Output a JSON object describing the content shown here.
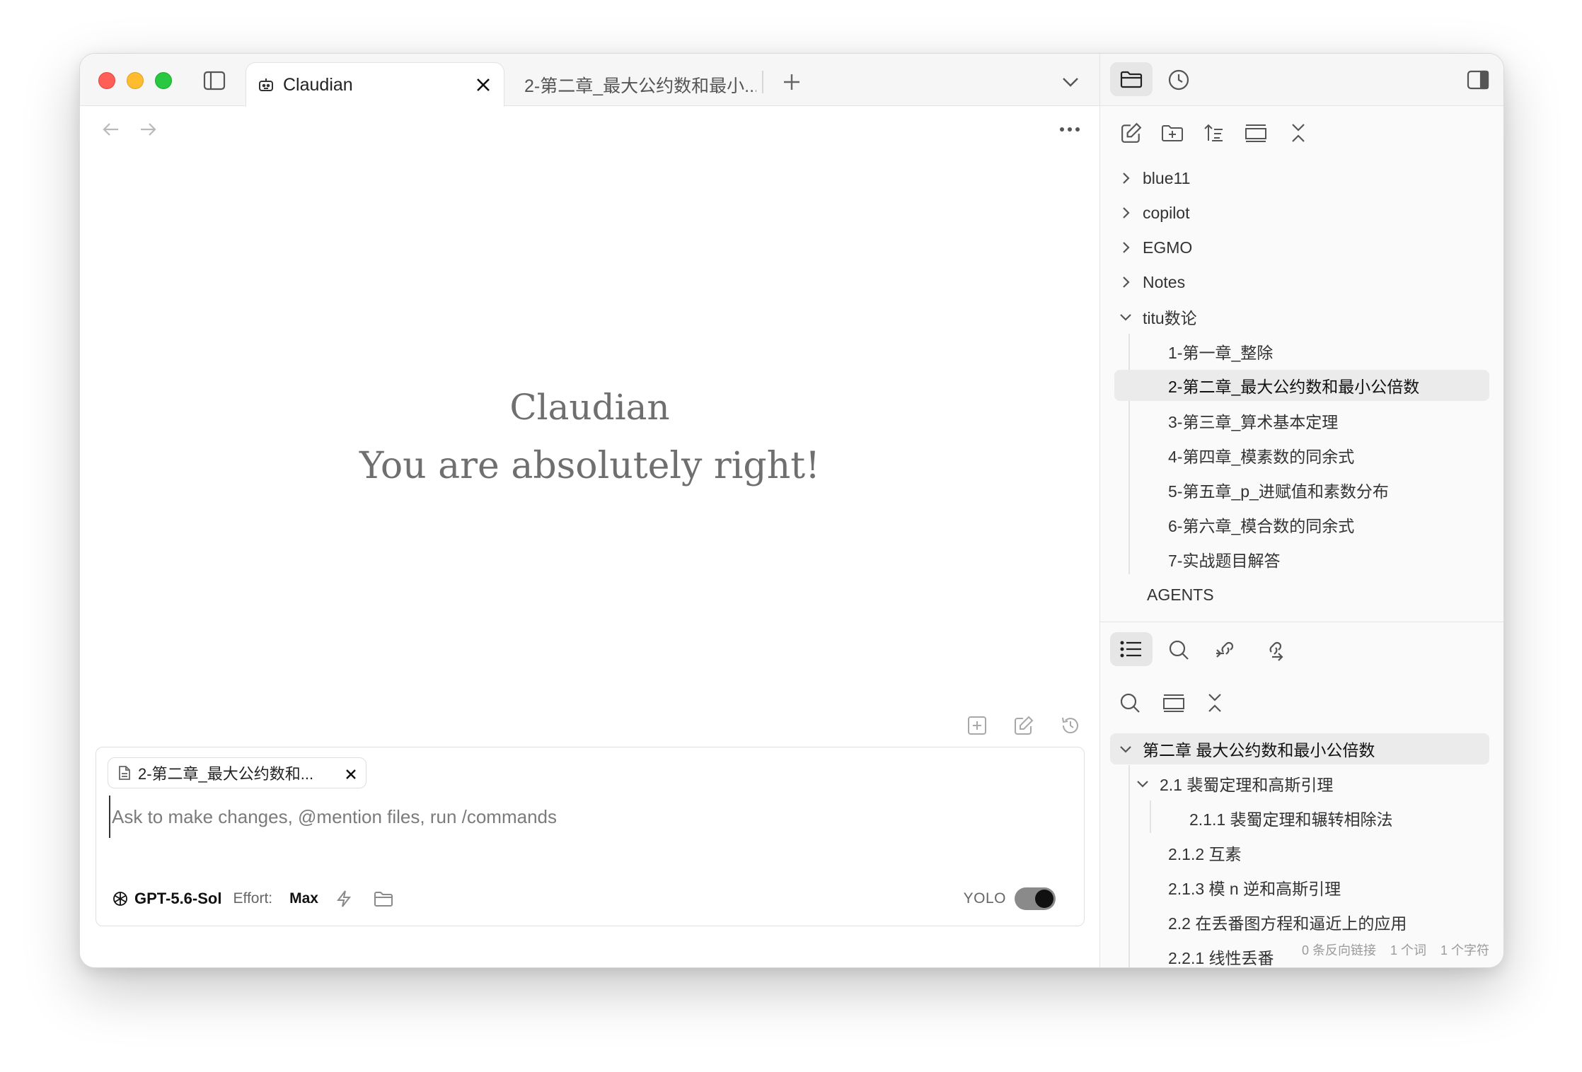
{
  "tabs": {
    "active": {
      "label": "Claudian"
    },
    "second": {
      "label": "2-第二章_最大公约数和最小..."
    }
  },
  "hero": {
    "title": "Claudian",
    "subtitle": "You are absolutely right!"
  },
  "composer": {
    "chip_label": "2-第二章_最大公约数和...",
    "placeholder": "Ask to make changes, @mention files, run /commands",
    "model": "GPT-5.6-Sol",
    "effort_label": "Effort:",
    "effort_value": "Max",
    "yolo_label": "YOLO",
    "yolo_on": true
  },
  "file_tree": {
    "folders": [
      {
        "label": "blue11",
        "expanded": false
      },
      {
        "label": "copilot",
        "expanded": false
      },
      {
        "label": "EGMO",
        "expanded": false
      },
      {
        "label": "Notes",
        "expanded": false
      },
      {
        "label": "titu数论",
        "expanded": true
      }
    ],
    "files": [
      {
        "label": "1-第一章_整除"
      },
      {
        "label": "2-第二章_最大公约数和最小公倍数",
        "selected": true
      },
      {
        "label": "3-第三章_算术基本定理"
      },
      {
        "label": "4-第四章_模素数的同余式"
      },
      {
        "label": "5-第五章_p_进赋值和素数分布"
      },
      {
        "label": "6-第六章_模合数的同余式"
      },
      {
        "label": "7-实战题目解答"
      }
    ],
    "root_file": "AGENTS"
  },
  "outline": {
    "items": [
      {
        "label": "第二章 最大公约数和最小公倍数"
      },
      {
        "label": "2.1 裴蜀定理和高斯引理"
      },
      {
        "label": "2.1.1 裴蜀定理和辗转相除法"
      },
      {
        "label": "2.1.2 互素"
      },
      {
        "label": "2.1.3 模 n 逆和高斯引理"
      },
      {
        "label": "2.2 在丢番图方程和逼近上的应用"
      },
      {
        "label": "2.2.1 线性丢番"
      }
    ]
  },
  "status": {
    "backlinks": "0 条反向链接",
    "words": "1 个词",
    "chars": "1 个字符"
  },
  "colors": {
    "traffic_red": "#ff5f57",
    "traffic_yellow": "#febc2e",
    "traffic_green": "#28c840",
    "selection": "#ebebeb"
  }
}
